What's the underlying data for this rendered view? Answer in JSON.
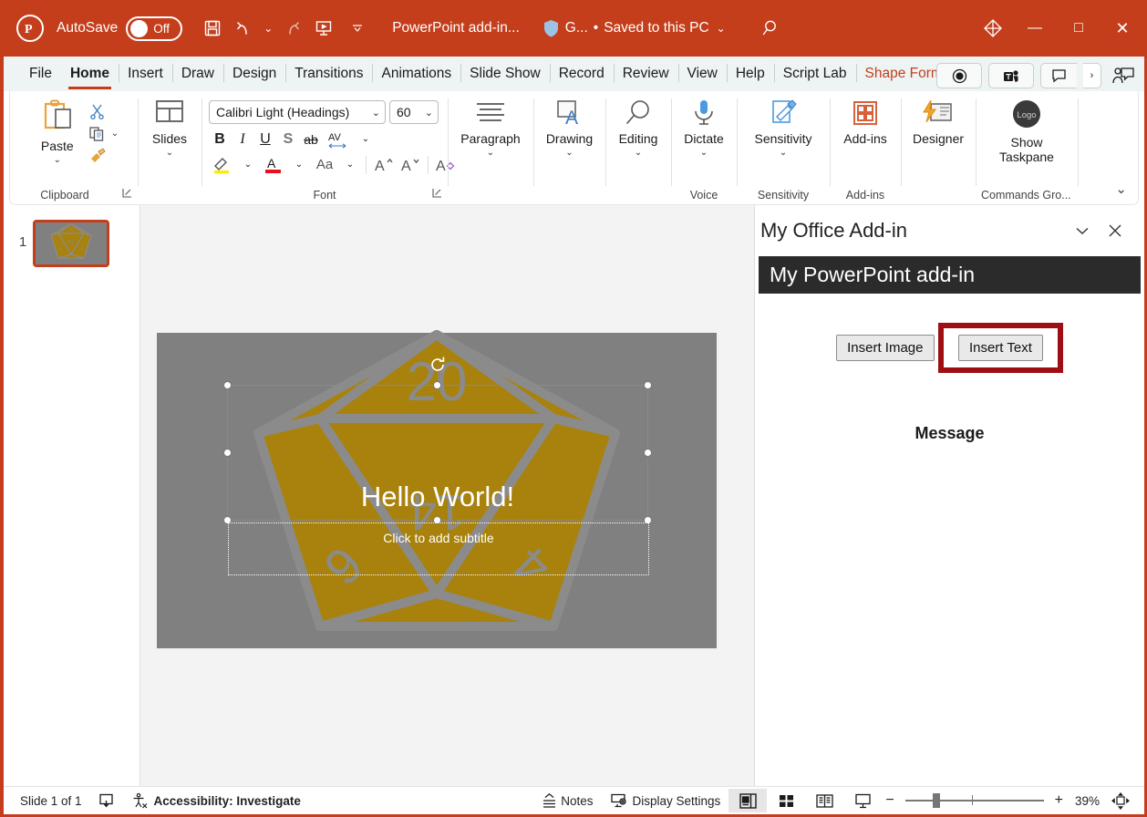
{
  "titlebar": {
    "app_icon": "powerpoint-logo-icon",
    "autosave_label": "AutoSave",
    "autosave_state": "Off",
    "save_icon": "save-icon",
    "undo_icon": "undo-icon",
    "redo_icon": "redo-icon",
    "present_icon": "start-presentation-icon",
    "customize_icon": "customize-quick-access-icon",
    "document_title": "PowerPoint add-in...",
    "sensitivity_label": "G...",
    "save_status": "Saved to this PC",
    "separator_dot": "•",
    "search_icon": "search-icon",
    "diamond_icon": "office-diamond-icon",
    "minimize": "—",
    "maximize": "□",
    "close": "✕"
  },
  "ribbon_tabs": [
    {
      "label": "File",
      "active": false,
      "accent": false
    },
    {
      "label": "Home",
      "active": true,
      "accent": false
    },
    {
      "label": "Insert",
      "active": false,
      "accent": false
    },
    {
      "label": "Draw",
      "active": false,
      "accent": false
    },
    {
      "label": "Design",
      "active": false,
      "accent": false
    },
    {
      "label": "Transitions",
      "active": false,
      "accent": false
    },
    {
      "label": "Animations",
      "active": false,
      "accent": false
    },
    {
      "label": "Slide Show",
      "active": false,
      "accent": false
    },
    {
      "label": "Record",
      "active": false,
      "accent": false
    },
    {
      "label": "Review",
      "active": false,
      "accent": false
    },
    {
      "label": "View",
      "active": false,
      "accent": false
    },
    {
      "label": "Help",
      "active": false,
      "accent": false
    },
    {
      "label": "Script Lab",
      "active": false,
      "accent": false
    },
    {
      "label": "Shape Format",
      "active": false,
      "accent": true
    }
  ],
  "tabbar_right": {
    "record_icon": "record-button-icon",
    "teams_icon": "teams-icon",
    "comments_icon": "comments-icon",
    "comments_chevron": "›",
    "share_icon": "share-icon"
  },
  "ribbon": {
    "clipboard": {
      "group_label": "Clipboard",
      "paste_label": "Paste",
      "paste_icon": "paste-icon",
      "cut_icon": "cut-scissors-icon",
      "copy_icon": "copy-icon",
      "copy_chevron": "⌄",
      "format_painter_icon": "format-painter-icon",
      "expander_icon": "dialog-launcher-icon"
    },
    "slides": {
      "group_label": "",
      "label": "Slides",
      "icon": "slide-layout-icon",
      "caret": "⌄"
    },
    "font": {
      "group_label": "Font",
      "font_name": "Calibri Light (Headings)",
      "font_size": "60",
      "bold": "B",
      "italic": "I",
      "underline": "U",
      "shadow": "S",
      "strikethrough": "ab",
      "character_spacing": "AV",
      "highlight_icon": "text-highlight-icon",
      "font_color_icon": "font-color-icon",
      "change_case": "Aa",
      "increase_size": "A",
      "decrease_size": "A",
      "clear_formatting_icon": "clear-formatting-icon",
      "expander_icon": "dialog-launcher-icon"
    },
    "paragraph": {
      "label": "Paragraph",
      "icon": "paragraph-icon",
      "caret": "⌄"
    },
    "drawing": {
      "label": "Drawing",
      "icon": "drawing-shapes-icon",
      "caret": "⌄"
    },
    "editing": {
      "label": "Editing",
      "icon": "editing-search-icon",
      "caret": "⌄"
    },
    "voice": {
      "group_label": "Voice",
      "label": "Dictate",
      "icon": "microphone-icon",
      "caret": "⌄"
    },
    "sensitivity": {
      "group_label": "Sensitivity",
      "label": "Sensitivity",
      "icon": "sensitivity-icon",
      "caret": "⌄"
    },
    "addins": {
      "group_label": "Add-ins",
      "label": "Add-ins",
      "icon": "add-ins-grid-icon"
    },
    "designer": {
      "label": "Designer",
      "icon": "designer-icon"
    },
    "commands_group": {
      "group_label": "Commands Gro...",
      "label_line1": "Show",
      "label_line2": "Taskpane",
      "icon_text": "Logo",
      "icon": "addin-logo-icon"
    },
    "collapse_icon": "ribbon-collapse-chevron-icon"
  },
  "thumbnails": {
    "slides": [
      {
        "number": "1",
        "selected": true
      }
    ]
  },
  "slide": {
    "title_text": "Hello World!",
    "subtitle_placeholder": "Click to add subtitle",
    "background_color": "#808080",
    "image_name": "d20-dice-icon",
    "image_color": "#a8820c",
    "rotate_handle_icon": "rotate-handle-icon"
  },
  "taskpane": {
    "title": "My Office Add-in",
    "collapse_icon": "chevron-down-icon",
    "close_icon": "close-icon",
    "addin_header": "My PowerPoint add-in",
    "insert_image_button": "Insert Image",
    "insert_text_button": "Insert Text",
    "message_label": "Message",
    "highlight_color": "#9e0e12"
  },
  "statusbar": {
    "slide_count": "Slide 1 of 1",
    "notes_page_icon": "notes-page-icon",
    "accessibility_icon": "accessibility-icon",
    "accessibility_label": "Accessibility: Investigate",
    "notes_icon": "notes-icon",
    "notes_label": "Notes",
    "display_settings_icon": "display-settings-icon",
    "display_settings_label": "Display Settings",
    "view_normal_icon": "view-normal-icon",
    "view_sorter_icon": "view-slide-sorter-icon",
    "view_reading_icon": "view-reading-icon",
    "view_slideshow_icon": "view-slideshow-icon",
    "zoom_out": "−",
    "zoom_in": "+",
    "zoom_level": "39%",
    "fit_slide_icon": "fit-slide-icon"
  },
  "colors": {
    "accent": "#c43e1c",
    "ribbon_bg": "#eef3f3",
    "highlight": "#9e0e12",
    "addin_header_bg": "#2b2b2b"
  }
}
